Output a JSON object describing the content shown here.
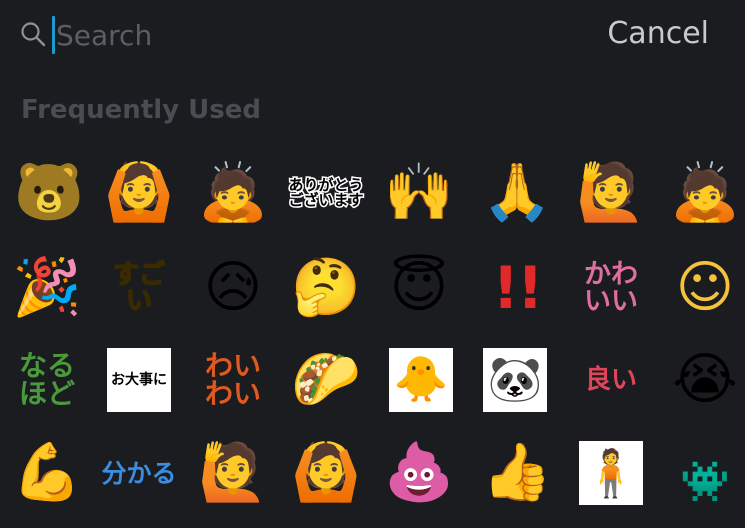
{
  "search": {
    "placeholder": "Search",
    "value": ""
  },
  "cancel_label": "Cancel",
  "section_title": "Frequently Used",
  "emojis": [
    {
      "name": "bear-custom-emoji",
      "glyph": "🐻"
    },
    {
      "name": "ok-gesture-emoji",
      "glyph": "🙆"
    },
    {
      "name": "bowing-emoji",
      "glyph": "🙇"
    },
    {
      "name": "arigatou-text-emoji",
      "text": "ありがとう\nございます"
    },
    {
      "name": "raising-hands-emoji",
      "glyph": "🙌"
    },
    {
      "name": "folded-hands-emoji",
      "glyph": "🙏"
    },
    {
      "name": "raising-hand-emoji",
      "glyph": "🙋"
    },
    {
      "name": "bowing-emoji-2",
      "glyph": "🙇"
    },
    {
      "name": "party-popper-emoji",
      "glyph": "🎉"
    },
    {
      "name": "sugoi-text-emoji",
      "text": "すごい"
    },
    {
      "name": "sad-relieved-emoji",
      "glyph": "😥"
    },
    {
      "name": "thinking-emoji",
      "glyph": "🤔"
    },
    {
      "name": "halo-emoji",
      "glyph": "😇"
    },
    {
      "name": "double-exclamation-emoji",
      "glyph": "!!"
    },
    {
      "name": "kawaii-text-emoji",
      "text": "かわ\nいい"
    },
    {
      "name": "relaxed-emoji",
      "glyph": "☺"
    },
    {
      "name": "naruhodo-text-emoji",
      "text": "なる\nほど"
    },
    {
      "name": "odaijini-text-emoji",
      "text": "お大事に"
    },
    {
      "name": "waiwai-text-emoji",
      "text": "わい\nわい"
    },
    {
      "name": "taco-face-emoji",
      "glyph": "🌮"
    },
    {
      "name": "bird-custom-emoji",
      "glyph": "🐥"
    },
    {
      "name": "panda-custom-emoji",
      "glyph": "🐼"
    },
    {
      "name": "yoi-text-emoji",
      "text": "良い"
    },
    {
      "name": "sob-emoji",
      "glyph": "😭"
    },
    {
      "name": "flexed-biceps-emoji",
      "glyph": "💪"
    },
    {
      "name": "wakaru-text-emoji",
      "text": "分かる"
    },
    {
      "name": "raising-hand-emoji-2",
      "glyph": "🙋"
    },
    {
      "name": "ok-gesture-emoji-2",
      "glyph": "🙆"
    },
    {
      "name": "poop-emoji",
      "glyph": "💩"
    },
    {
      "name": "thumbs-up-emoji",
      "glyph": "👍"
    },
    {
      "name": "man-standing-custom-emoji",
      "glyph": "🧍"
    },
    {
      "name": "pixel-creature-custom-emoji",
      "glyph": "👾"
    }
  ],
  "colors": {
    "accent": "#1d9bd1",
    "background": "#1b1c20"
  }
}
